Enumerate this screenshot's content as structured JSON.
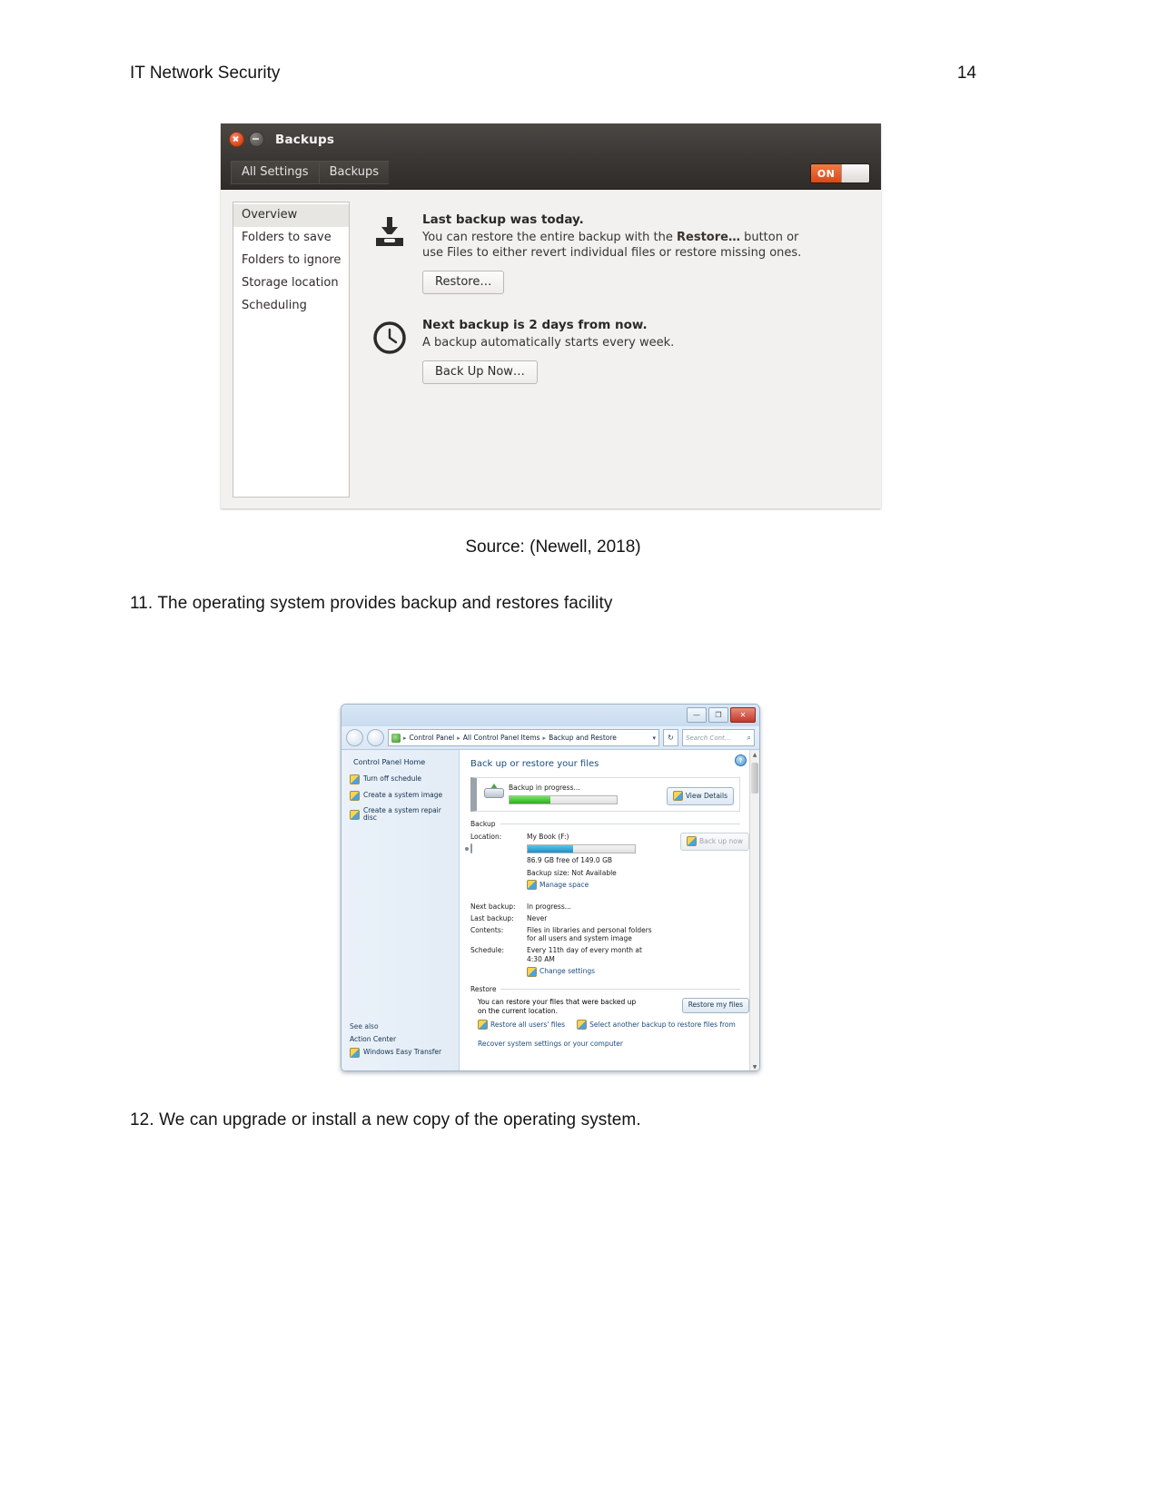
{
  "document": {
    "header_title": "IT Network Security",
    "page_number": "14",
    "caption": "Source: (Newell, 2018)",
    "item_11": "11. The operating system provides backup and restores facility",
    "item_12": "12. We can upgrade or install a new copy of the operating system."
  },
  "ubuntu_backups": {
    "title": "Backups",
    "toolbar": {
      "all_settings": "All Settings",
      "backups": "Backups",
      "toggle_state": "ON"
    },
    "sidebar": [
      {
        "label": "Overview"
      },
      {
        "label": "Folders to save"
      },
      {
        "label": "Folders to ignore"
      },
      {
        "label": "Storage location"
      },
      {
        "label": "Scheduling"
      }
    ],
    "last_backup": {
      "title": "Last backup was today.",
      "desc_before": "You can restore the entire backup with the ",
      "desc_bold": "Restore…",
      "desc_after": " button or use Files to either revert individual files or restore missing ones.",
      "button": "Restore…"
    },
    "next_backup": {
      "title": "Next backup is 2 days from now.",
      "desc": "A backup automatically starts every week.",
      "button": "Back Up Now…"
    },
    "colors": {
      "accent": "#dd4814",
      "titlebar": "#3c3835"
    }
  },
  "win7_backup": {
    "window_buttons": {
      "minimize": "—",
      "maximize": "❐",
      "close": "✕"
    },
    "breadcrumb": [
      "Control Panel",
      "All Control Panel Items",
      "Backup and Restore"
    ],
    "search_placeholder": "Search Cont...",
    "sidebar": {
      "home": "Control Panel Home",
      "links": [
        "Turn off schedule",
        "Create a system image",
        "Create a system repair disc"
      ],
      "see_also_title": "See also",
      "see_also": [
        "Action Center",
        "Windows Easy Transfer"
      ]
    },
    "heading": "Back up or restore your files",
    "progress": {
      "label": "Backup in progress...",
      "percent": 38,
      "view_details_button": "View Details"
    },
    "backup_section": {
      "title": "Backup",
      "location_label": "Location:",
      "location_value": "My Book (F:)",
      "disk_percent": 42,
      "free_space": "86.9 GB free of 149.0 GB",
      "backup_size": "Backup size: Not Available",
      "manage_space_link": "Manage space",
      "back_up_now_button": "Back up now",
      "rows": [
        {
          "k": "Next backup:",
          "v": "In progress..."
        },
        {
          "k": "Last backup:",
          "v": "Never"
        },
        {
          "k": "Contents:",
          "v": "Files in libraries and personal folders for all users and system image"
        },
        {
          "k": "Schedule:",
          "v": "Every 11th day of every month at 4:30 AM"
        }
      ],
      "change_settings_link": "Change settings"
    },
    "restore_section": {
      "title": "Restore",
      "desc": "You can restore your files that were backed up on the current location.",
      "restore_my_files_button": "Restore my files",
      "links": [
        "Restore all users' files",
        "Select another backup to restore files from"
      ],
      "recover_link": "Recover system settings or your computer"
    }
  }
}
